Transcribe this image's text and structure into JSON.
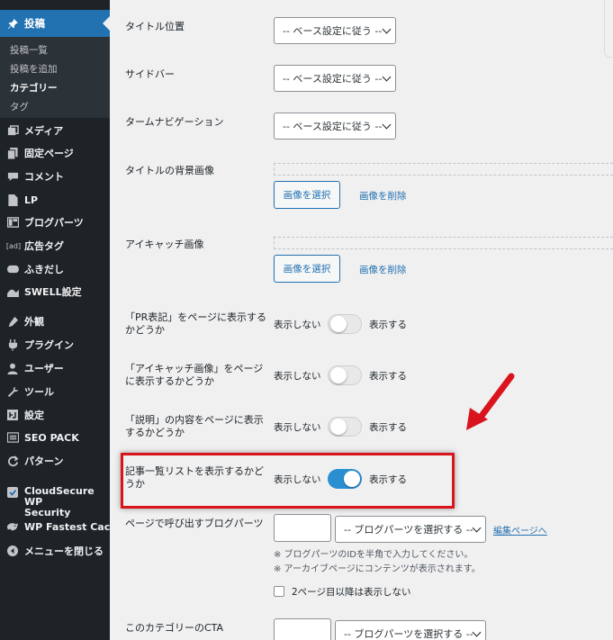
{
  "sidebar": {
    "current_menu": "投稿",
    "submenu": [
      "投稿一覧",
      "投稿を追加",
      "カテゴリー",
      "タグ"
    ],
    "items": [
      {
        "label": "メディア",
        "icon": "media-icon"
      },
      {
        "label": "固定ページ",
        "icon": "page-icon"
      },
      {
        "label": "コメント",
        "icon": "comment-icon"
      },
      {
        "label": "LP",
        "icon": "document-icon"
      },
      {
        "label": "ブログパーツ",
        "icon": "layout-icon"
      },
      {
        "label": "広告タグ",
        "icon": "ad-icon",
        "icon_text": "[ad]"
      },
      {
        "label": "ふきだし",
        "icon": "bubble-icon"
      },
      {
        "label": "SWELL設定",
        "icon": "swell-icon"
      },
      {
        "label": "外観",
        "icon": "appearance-icon"
      },
      {
        "label": "プラグイン",
        "icon": "plugin-icon"
      },
      {
        "label": "ユーザー",
        "icon": "user-icon"
      },
      {
        "label": "ツール",
        "icon": "wrench-icon"
      },
      {
        "label": "設定",
        "icon": "settings-icon"
      },
      {
        "label": "SEO PACK",
        "icon": "seo-icon"
      },
      {
        "label": "パターン",
        "icon": "pattern-icon"
      }
    ],
    "cloudsecure": [
      "CloudSecure WP",
      "Security"
    ],
    "fastest_cache": "WP Fastest Cache",
    "collapse": "メニューを閉じる"
  },
  "main": {
    "title_position_label": "タイトル位置",
    "title_position_value": "-- ベース設定に従う --",
    "sidebar_label": "サイドバー",
    "sidebar_value": "-- ベース設定に従う --",
    "term_nav_label": "タームナビゲーション",
    "term_nav_value": "-- ベース設定に従う --",
    "title_bg_label": "タイトルの背景画像",
    "eyecatch_label": "アイキャッチ画像",
    "select_image": "画像を選択",
    "delete_image": "画像を削除",
    "pr_label": [
      "「PR表記」をページに表示する",
      "かどうか"
    ],
    "eyecatch_show_label": [
      "「アイキャッチ画像」をページ",
      "に表示するかどうか"
    ],
    "desc_label": [
      "「説明」の内容をページに表示",
      "するかどうか"
    ],
    "list_label": [
      "記事一覧リストを表示するかど",
      "うか"
    ],
    "hide_text": "表示しない",
    "show_text": "表示する",
    "toggles": {
      "pr": false,
      "eyecatch": false,
      "desc": false,
      "list": true
    },
    "blogparts_label": "ページで呼び出すブログパーツ",
    "blogparts_select": "-- ブログパーツを選択する --",
    "edit_page": "編集ページへ",
    "note1": "※ ブログパーツのIDを半角で入力してください。",
    "note2": "※ アーカイブページにコンテンツが表示されます。",
    "checkbox_label": "2ページ目以降は表示しない",
    "cta_label": "このカテゴリーのCTA",
    "cta_select": "-- ブログパーツを選択する --"
  },
  "colors": {
    "sidebar_bg": "#1d2327",
    "accent": "#2271b1",
    "toggle_on": "#2a8fd1",
    "highlight": "#d9141d"
  }
}
